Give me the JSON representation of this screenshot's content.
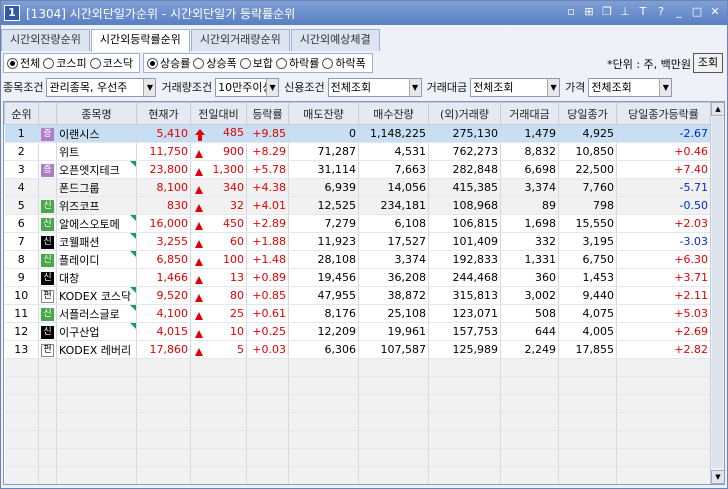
{
  "title": {
    "num": "1",
    "text": "[1304] 시간외단일가순위 - 시간외단일가 등락률순위"
  },
  "title_controls": [
    "▫",
    "⊞",
    "❐",
    "⊥",
    "T",
    "?",
    "_",
    "□",
    "✕"
  ],
  "tabs": [
    "시간외잔량순위",
    "시간외등락률순위",
    "시간외거래량순위",
    "시간외예상체결"
  ],
  "market_radios": [
    "전체",
    "코스피",
    "코스닥"
  ],
  "sort_radios": [
    "상승률",
    "상승폭",
    "보합",
    "하락률",
    "하락폭"
  ],
  "unit_text": "*단위 : 주, 백만원",
  "query_label": "조회",
  "filters": {
    "stock_cond_label": "종목조건",
    "stock_cond_value": "관리종목, 우선주",
    "volume_cond_label": "거래량조건",
    "volume_cond_value": "10만주이상",
    "credit_cond_label": "신용조건",
    "credit_cond_value": "전체조회",
    "amount_label": "거래대금",
    "amount_value": "전체조회",
    "price_label": "가격",
    "price_value": "전체조회"
  },
  "columns": [
    "순위",
    "",
    "종목명",
    "현재가",
    "전일대비",
    "등락률",
    "매도잔량",
    "매수잔량",
    "(외)거래량",
    "거래대금",
    "당일종가",
    "당일종가등락률"
  ],
  "rows": [
    {
      "rank": "1",
      "badge": "증",
      "badge_color": "purple",
      "name": "이랜시스",
      "price": "5,410",
      "arrow": "bigup",
      "change": "485",
      "rate": "+9.85",
      "sell": "0",
      "buy": "1,148,225",
      "vol": "275,130",
      "amt": "1,479",
      "close": "4,925",
      "close_rate": "-2.67",
      "rate_color": "blue",
      "corner": false
    },
    {
      "rank": "2",
      "badge": "",
      "badge_color": "",
      "name": "위트",
      "price": "11,750",
      "arrow": "up",
      "change": "900",
      "rate": "+8.29",
      "sell": "71,287",
      "buy": "4,531",
      "vol": "762,273",
      "amt": "8,832",
      "close": "10,850",
      "close_rate": "+0.46",
      "rate_color": "red",
      "corner": false
    },
    {
      "rank": "3",
      "badge": "증",
      "badge_color": "purple",
      "name": "오픈엣지테크",
      "price": "23,800",
      "arrow": "up",
      "change": "1,300",
      "rate": "+5.78",
      "sell": "31,114",
      "buy": "7,663",
      "vol": "282,848",
      "amt": "6,698",
      "close": "22,500",
      "close_rate": "+7.40",
      "rate_color": "red",
      "corner": true
    },
    {
      "rank": "4",
      "badge": "",
      "badge_color": "",
      "name": "폰드그룹",
      "price": "8,100",
      "arrow": "up",
      "change": "340",
      "rate": "+4.38",
      "sell": "6,939",
      "buy": "14,056",
      "vol": "415,385",
      "amt": "3,374",
      "close": "7,760",
      "close_rate": "-5.71",
      "rate_color": "blue",
      "corner": false
    },
    {
      "rank": "5",
      "badge": "신",
      "badge_color": "green",
      "name": "위즈코프",
      "price": "830",
      "arrow": "up",
      "change": "32",
      "rate": "+4.01",
      "sell": "12,525",
      "buy": "234,181",
      "vol": "108,968",
      "amt": "89",
      "close": "798",
      "close_rate": "-0.50",
      "rate_color": "blue",
      "corner": false
    },
    {
      "rank": "6",
      "badge": "신",
      "badge_color": "green",
      "name": "알에스오토메",
      "price": "16,000",
      "arrow": "up",
      "change": "450",
      "rate": "+2.89",
      "sell": "7,279",
      "buy": "6,108",
      "vol": "106,815",
      "amt": "1,698",
      "close": "15,550",
      "close_rate": "+2.03",
      "rate_color": "red",
      "corner": true
    },
    {
      "rank": "7",
      "badge": "신",
      "badge_color": "black",
      "name": "코웰패션",
      "price": "3,255",
      "arrow": "up",
      "change": "60",
      "rate": "+1.88",
      "sell": "11,923",
      "buy": "17,527",
      "vol": "101,409",
      "amt": "332",
      "close": "3,195",
      "close_rate": "-3.03",
      "rate_color": "blue",
      "corner": true
    },
    {
      "rank": "8",
      "badge": "신",
      "badge_color": "green",
      "name": "플레이디",
      "price": "6,850",
      "arrow": "up",
      "change": "100",
      "rate": "+1.48",
      "sell": "28,108",
      "buy": "3,374",
      "vol": "192,833",
      "amt": "1,331",
      "close": "6,750",
      "close_rate": "+6.30",
      "rate_color": "red",
      "corner": true
    },
    {
      "rank": "9",
      "badge": "신",
      "badge_color": "black",
      "name": "대창",
      "price": "1,466",
      "arrow": "up",
      "change": "13",
      "rate": "+0.89",
      "sell": "19,456",
      "buy": "36,208",
      "vol": "244,468",
      "amt": "360",
      "close": "1,453",
      "close_rate": "+3.71",
      "rate_color": "red",
      "corner": false
    },
    {
      "rank": "10",
      "badge": "펀",
      "badge_color": "white",
      "name": "KODEX 코스닥",
      "price": "9,520",
      "arrow": "up",
      "change": "80",
      "rate": "+0.85",
      "sell": "47,955",
      "buy": "38,872",
      "vol": "315,813",
      "amt": "3,002",
      "close": "9,440",
      "close_rate": "+2.11",
      "rate_color": "red",
      "corner": true
    },
    {
      "rank": "11",
      "badge": "신",
      "badge_color": "green",
      "name": "서플러스글로",
      "price": "4,100",
      "arrow": "up",
      "change": "25",
      "rate": "+0.61",
      "sell": "8,176",
      "buy": "25,108",
      "vol": "123,071",
      "amt": "508",
      "close": "4,075",
      "close_rate": "+5.03",
      "rate_color": "red",
      "corner": true
    },
    {
      "rank": "12",
      "badge": "신",
      "badge_color": "black",
      "name": "이구산업",
      "price": "4,015",
      "arrow": "up",
      "change": "10",
      "rate": "+0.25",
      "sell": "12,209",
      "buy": "19,961",
      "vol": "157,753",
      "amt": "644",
      "close": "4,005",
      "close_rate": "+2.69",
      "rate_color": "red",
      "corner": true
    },
    {
      "rank": "13",
      "badge": "펀",
      "badge_color": "white",
      "name": "KODEX 레버리",
      "price": "17,860",
      "arrow": "up",
      "change": "5",
      "rate": "+0.03",
      "sell": "6,306",
      "buy": "107,587",
      "vol": "125,989",
      "amt": "2,249",
      "close": "17,855",
      "close_rate": "+2.82",
      "rate_color": "red",
      "corner": false
    }
  ]
}
